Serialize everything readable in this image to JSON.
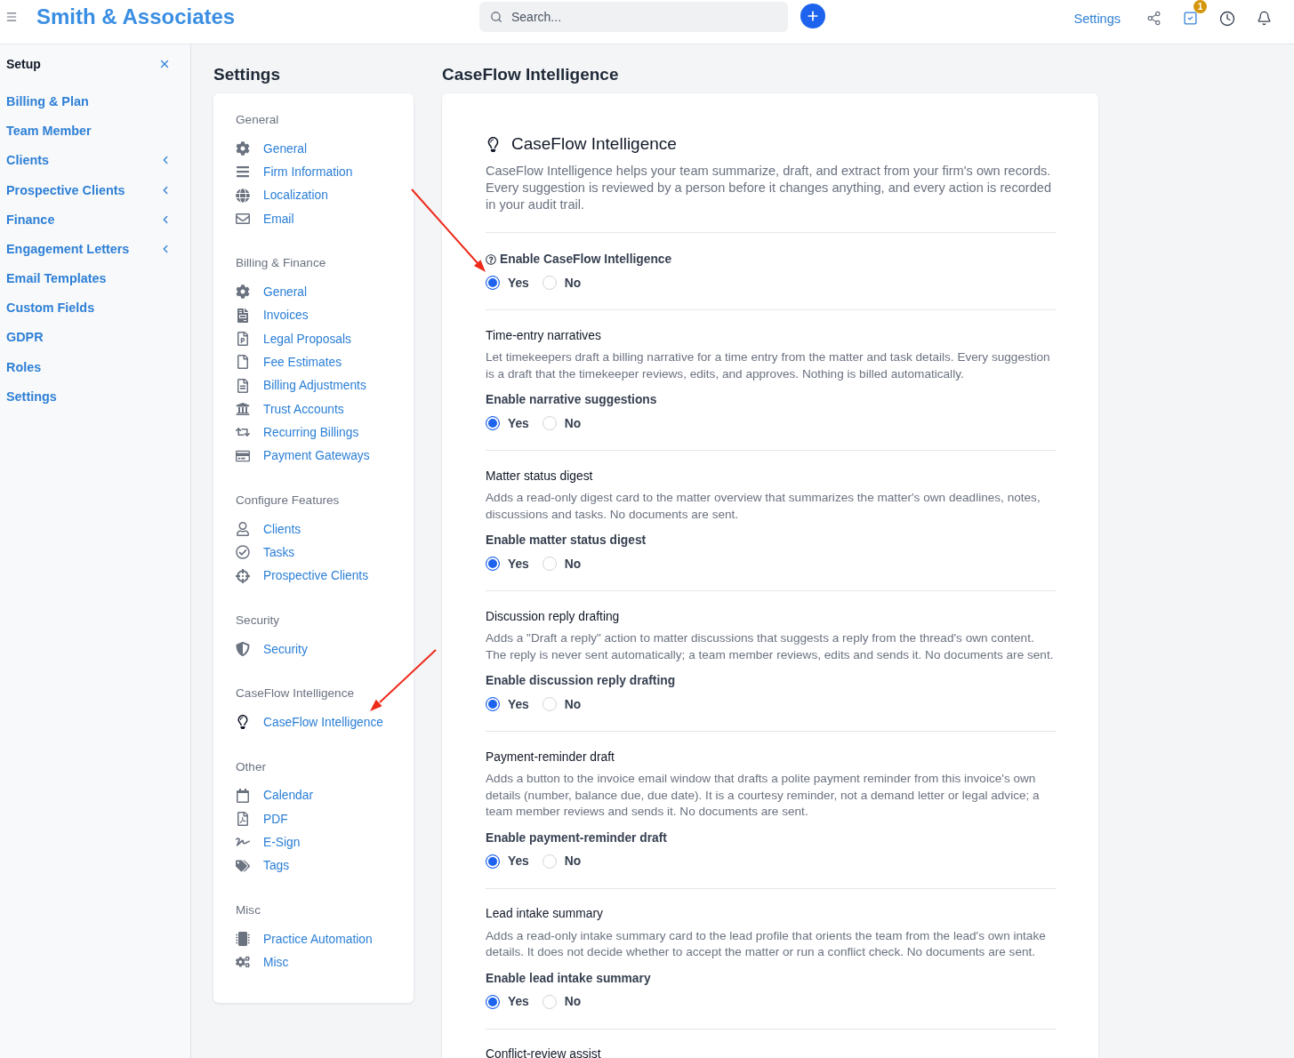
{
  "top_bar": {
    "brand": "Smith & Associates",
    "search": {
      "placeholder": "Search..."
    },
    "settings_link": "Settings",
    "tasks_badge": "1"
  },
  "sidebar": {
    "title": "Setup",
    "items": [
      {
        "label": "Billing & Plan",
        "has_submenu": false
      },
      {
        "label": "Team Member",
        "has_submenu": false
      },
      {
        "label": "Clients",
        "has_submenu": true
      },
      {
        "label": "Prospective Clients",
        "has_submenu": true
      },
      {
        "label": "Finance",
        "has_submenu": true
      },
      {
        "label": "Engagement Letters",
        "has_submenu": true
      },
      {
        "label": "Email Templates",
        "has_submenu": false
      },
      {
        "label": "Custom Fields",
        "has_submenu": false
      },
      {
        "label": "GDPR",
        "has_submenu": false
      },
      {
        "label": "Roles",
        "has_submenu": false
      },
      {
        "label": "Settings",
        "has_submenu": false
      }
    ]
  },
  "settings_nav": {
    "title": "Settings",
    "groups": [
      {
        "heading": "General",
        "items": [
          {
            "label": "General",
            "selected": false
          },
          {
            "label": "Firm Information",
            "selected": false
          },
          {
            "label": "Localization",
            "selected": false
          },
          {
            "label": "Email",
            "selected": false
          }
        ]
      },
      {
        "heading": "Billing & Finance",
        "items": [
          {
            "label": "General",
            "selected": false
          },
          {
            "label": "Invoices",
            "selected": false
          },
          {
            "label": "Legal Proposals",
            "selected": false
          },
          {
            "label": "Fee Estimates",
            "selected": false
          },
          {
            "label": "Billing Adjustments",
            "selected": false
          },
          {
            "label": "Trust Accounts",
            "selected": false
          },
          {
            "label": "Recurring Billings",
            "selected": false
          },
          {
            "label": "Payment Gateways",
            "selected": false
          }
        ]
      },
      {
        "heading": "Configure Features",
        "items": [
          {
            "label": "Clients",
            "selected": false
          },
          {
            "label": "Tasks",
            "selected": false
          },
          {
            "label": "Prospective Clients",
            "selected": false
          }
        ]
      },
      {
        "heading": "Security",
        "items": [
          {
            "label": "Security",
            "selected": false
          }
        ]
      },
      {
        "heading": "CaseFlow Intelligence",
        "items": [
          {
            "label": "CaseFlow Intelligence",
            "selected": true
          }
        ]
      },
      {
        "heading": "Other",
        "items": [
          {
            "label": "Calendar",
            "selected": false
          },
          {
            "label": "PDF",
            "selected": false
          },
          {
            "label": "E-Sign",
            "selected": false
          },
          {
            "label": "Tags",
            "selected": false
          }
        ]
      },
      {
        "heading": "Misc",
        "items": [
          {
            "label": "Practice Automation",
            "selected": false
          },
          {
            "label": "Misc",
            "selected": false
          }
        ]
      }
    ]
  },
  "content": {
    "title": "CaseFlow Intelligence",
    "card_title": "CaseFlow Intelligence",
    "description": "CaseFlow Intelligence helps your team summarize, draft, and extract from your firm's own records. Every suggestion is reviewed by a person before it changes anything, and every action is recorded in your audit trail.",
    "master_setting": {
      "label": "Enable CaseFlow Intelligence",
      "options": [
        {
          "label": "Yes",
          "selected": true
        },
        {
          "label": "No",
          "selected": false
        }
      ]
    },
    "features": [
      {
        "title": "Time-entry narratives",
        "description": "Let timekeepers draft a billing narrative for a time entry from the matter and task details. Every suggestion is a draft that the timekeeper reviews, edits, and approves. Nothing is billed automatically.",
        "label": "Enable narrative suggestions",
        "options": [
          {
            "label": "Yes",
            "selected": true
          },
          {
            "label": "No",
            "selected": false
          }
        ]
      },
      {
        "title": "Matter status digest",
        "description": "Adds a read-only digest card to the matter overview that summarizes the matter's own deadlines, notes, discussions and tasks. No documents are sent.",
        "label": "Enable matter status digest",
        "options": [
          {
            "label": "Yes",
            "selected": true
          },
          {
            "label": "No",
            "selected": false
          }
        ]
      },
      {
        "title": "Discussion reply drafting",
        "description": "Adds a \"Draft a reply\" action to matter discussions that suggests a reply from the thread's own content. The reply is never sent automatically; a team member reviews, edits and sends it. No documents are sent.",
        "label": "Enable discussion reply drafting",
        "options": [
          {
            "label": "Yes",
            "selected": true
          },
          {
            "label": "No",
            "selected": false
          }
        ]
      },
      {
        "title": "Payment-reminder draft",
        "description": "Adds a button to the invoice email window that drafts a polite payment reminder from this invoice's own details (number, balance due, due date). It is a courtesy reminder, not a demand letter or legal advice; a team member reviews and sends it. No documents are sent.",
        "label": "Enable payment-reminder draft",
        "options": [
          {
            "label": "Yes",
            "selected": true
          },
          {
            "label": "No",
            "selected": false
          }
        ]
      },
      {
        "title": "Lead intake summary",
        "description": "Adds a read-only intake summary card to the lead profile that orients the team from the lead's own intake details. It does not decide whether to accept the matter or run a conflict check. No documents are sent.",
        "label": "Enable lead intake summary",
        "options": [
          {
            "label": "Yes",
            "selected": true
          },
          {
            "label": "No",
            "selected": false
          }
        ]
      },
      {
        "title": "Conflict-review assist"
      }
    ]
  }
}
